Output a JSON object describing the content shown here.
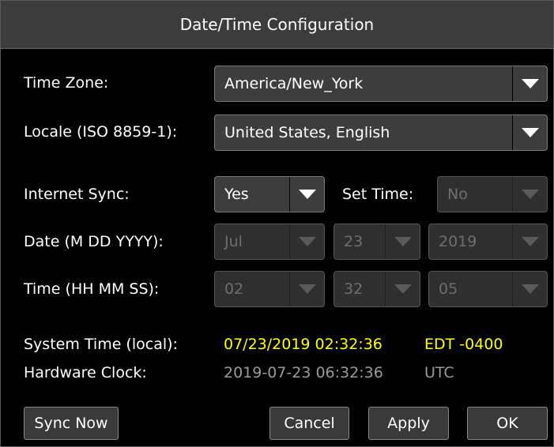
{
  "dialog": {
    "title": "Date/Time Configuration"
  },
  "timezone": {
    "label": "Time Zone:",
    "value": "America/New_York"
  },
  "locale": {
    "label": "Locale (ISO 8859-1):",
    "value": "United States, English"
  },
  "internet_sync": {
    "label": "Internet Sync:",
    "value": "Yes"
  },
  "set_time": {
    "label": "Set Time:",
    "value": "No"
  },
  "date": {
    "label": "Date (M DD YYYY):",
    "month": "Jul",
    "day": "23",
    "year": "2019"
  },
  "time": {
    "label": "Time (HH MM SS):",
    "hour": "02",
    "minute": "32",
    "second": "05"
  },
  "system_time": {
    "label": "System Time (local):",
    "value": "07/23/2019 02:32:36",
    "zone": "EDT -0400"
  },
  "hardware_clock": {
    "label": "Hardware Clock:",
    "value": "2019-07-23 06:32:36",
    "zone": "UTC"
  },
  "buttons": {
    "sync_now": "Sync Now",
    "cancel": "Cancel",
    "apply": "Apply",
    "ok": "OK"
  },
  "colors": {
    "highlight": "#ffff00",
    "dim_text": "#9a9a9a",
    "disabled_text": "#6e6e6e"
  },
  "icons": {
    "dropdown_arrow": "chevron-down-icon"
  }
}
